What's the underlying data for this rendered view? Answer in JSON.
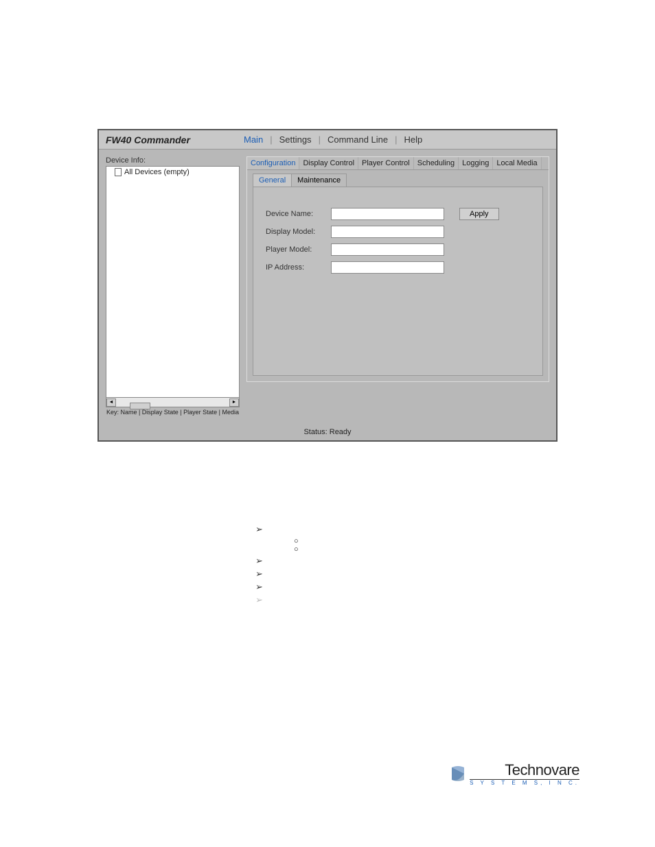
{
  "app": {
    "title": "FW40 Commander"
  },
  "menu": {
    "main": "Main",
    "settings": "Settings",
    "command_line": "Command Line",
    "help": "Help"
  },
  "sidebar": {
    "label": "Device Info:",
    "tree_root": "All Devices (empty)",
    "key": "Key: Name | Display State | Player State | Media"
  },
  "tabs": {
    "configuration": "Configuration",
    "display_control": "Display Control",
    "player_control": "Player Control",
    "scheduling": "Scheduling",
    "logging": "Logging",
    "local_media": "Local Media"
  },
  "subtabs": {
    "general": "General",
    "maintenance": "Maintenance"
  },
  "form": {
    "device_name": "Device Name:",
    "display_model": "Display Model:",
    "player_model": "Player Model:",
    "ip_address": "IP Address:",
    "apply": "Apply"
  },
  "status": {
    "text": "Status: Ready"
  },
  "logo": {
    "main": "Technovare",
    "sub": "S Y S T E M S,  I N C."
  }
}
